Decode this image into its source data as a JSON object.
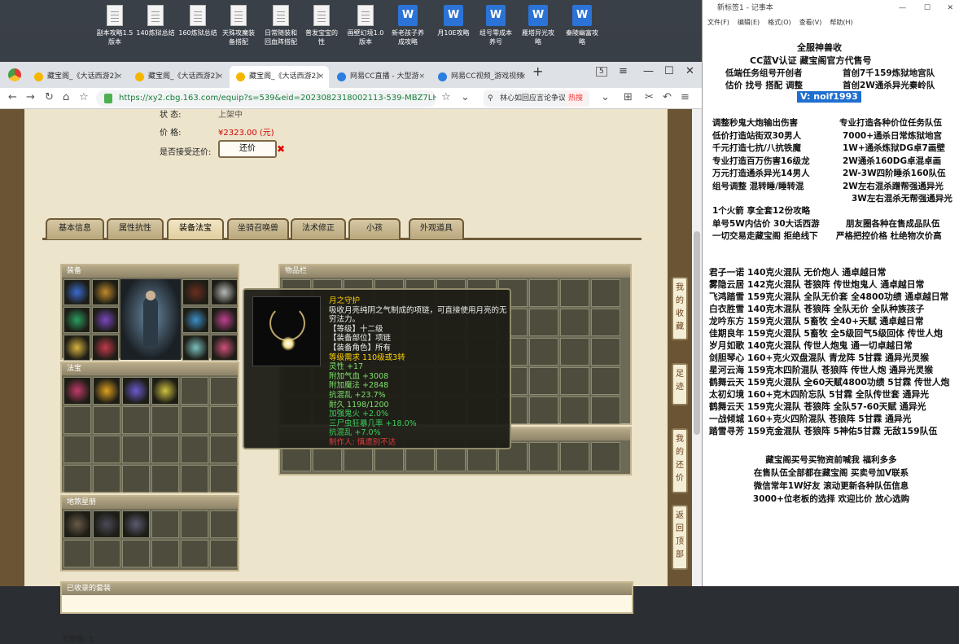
{
  "desktop": {
    "icons": [
      {
        "label": "副本攻略1.5\n版本",
        "type": "file"
      },
      {
        "label": "140炼狱总结",
        "type": "file"
      },
      {
        "label": "160炼狱总结",
        "type": "file"
      },
      {
        "label": "天殊攻魔装\n备搭配",
        "type": "file"
      },
      {
        "label": "日常随装和\n回血阵搭配",
        "type": "file"
      },
      {
        "label": "普发宝宝的\n性",
        "type": "file"
      },
      {
        "label": "画壁幻境1.0\n版本",
        "type": "file"
      },
      {
        "label": "新老孩子养\n成攻略",
        "type": "word"
      },
      {
        "label": "月10E攻略",
        "type": "word"
      },
      {
        "label": "组号零成本\n养号",
        "type": "word"
      },
      {
        "label": "雁塔异光攻\n略",
        "type": "word"
      },
      {
        "label": "秦陵幽富攻\n略",
        "type": "word"
      }
    ]
  },
  "browser": {
    "tabs": [
      "藏宝阁_《大话西游2》",
      "藏宝阁_《大话西游2》",
      "藏宝阁_《大话西游2》",
      "网易CC直播 - 大型游",
      "网易CC视频_游戏视频"
    ],
    "url": "https://xy2.cbg.163.com/equip?s=539&eid=2023082318002113-539-MBZ7LHZEWYY",
    "search": "林心如回应言论争议",
    "hot": "热搜",
    "tab_num": "5"
  },
  "item": {
    "status_label": "状        态:",
    "status_value": "上架中",
    "price_label": "价        格:",
    "price_value": "¥2323.00 (元)",
    "bargain_label": "是否接受还价:",
    "bargain_button": "还价",
    "tabs": [
      "基本信息",
      "属性抗性",
      "装备法宝",
      "坐骑召唤兽",
      "法术修正",
      "小孩",
      "外观道具"
    ],
    "panels": {
      "equip": "装备",
      "items": "物品栏",
      "fabao": "法宝",
      "land": "地煞星册",
      "suits": "已收录的套装",
      "lingxiu": "灵修值:  5"
    }
  },
  "tooltip": {
    "name": "月之守护",
    "desc": "吸收月亮纯阴之气制成的项链，可直接使用月亮的无穷法力。",
    "level": "【等级】十二级",
    "slot": "【装备部位】项链",
    "role": "【装备角色】所有",
    "req": "等级需求 110级或3转",
    "stats_green": [
      "灵性 +17",
      "附加气血 +3008",
      "附加魔法 +2848",
      "抗混乱 +23.7%",
      "耐久 1198/1200"
    ],
    "stats_extra": [
      "加强鬼火 +2.0%",
      "三尸虫狂暴几率 +18.0%",
      "抗混乱 +7.0%"
    ],
    "maker": "制作人: 慎遗别不达"
  },
  "side_buttons": [
    "我的收藏",
    "足迹",
    "我的还价",
    "返回顶部"
  ],
  "notepad": {
    "title": "新标签1 - 记事本",
    "menu": [
      "文件(F)",
      "编辑(E)",
      "格式(O)",
      "查看(V)",
      "帮助(H)"
    ],
    "header1": "全服神兽收",
    "header2": "CC蓝V认证  藏宝阁官方代售号",
    "r1a": "低端任务组号开创者",
    "r1b": "首创7千159炼狱地宫队",
    "r2a": "估价 找号 搭配 调整",
    "r2b": "首创2W通杀异光秦岭队",
    "vline": "V: noif1993",
    "services": [
      [
        "调整秒鬼大炮输出伤害",
        "专业打造各种价位任务队伍"
      ],
      [
        "低价打造站街双30男人",
        "7000+通杀日常炼狱地宫"
      ],
      [
        "千元打造七抗/八抗铁魔",
        "1W+通杀炼狱DG卓7画壁"
      ],
      [
        "专业打造百万伤害16级龙",
        "2W通杀160DG卓混卓画"
      ],
      [
        "万元打造通杀异光14男人",
        "2W-3W四阶睡杀160队伍"
      ],
      [
        "组号调整 混转睡/睡转混",
        "2W左右混杀蹭帮强通异光"
      ]
    ],
    "s7": "3W左右混杀无帮强通异光",
    "s8": "1个火箭 享全套12份攻略",
    "s9a": "单号5W内估价 30大话西游",
    "s9b": "朋友圈各种在售成品队伍",
    "s10a": "一切交易走藏宝阁 拒绝线下",
    "s10b": "严格把控价格 杜绝物次价高",
    "teams": [
      "君子一诺 140克火混队 无价炮人 通卓越日常",
      "雾隐云居 142克火混队 苍狼阵 传世炮鬼人 通卓越日常",
      "飞鸿踏雪 159克火混队 全队无价套 全4800功绩 通卓越日常",
      "白衣胜雪 140克木混队 苍狼阵 全队无价 全队种族孩子",
      "龙吟东方 159克火混队 5畜牧 全40+天赋 通卓越日常",
      "佳期良年 159克火混队 5畜牧 全5级回气5级回体 传世人炮",
      "岁月如歌 140克火混队 传世人炮鬼 通一切卓越日常",
      "剑胆琴心 160+克火双盘混队 青龙阵 5甘霖 通异光灵猴",
      "星河云海 159克木四阶混队 苍狼阵 传世人炮 通异光灵猴",
      "鹤舞云天 159克火混队 全60天赋4800功绩 5甘霖 传世人炮",
      "太初幻境 160+克木四阶忘队 5甘霖 全队传世套 通异光",
      "鹤舞云天 159克火混队 苍狼阵 全队57-60天赋 通异光",
      "一战倾城 160+克火四阶混队 苍狼阵 5甘霖 通异光",
      "踏雪寻芳 159克金混队 苍狼阵 5神佑5甘霖 无敌159队伍"
    ],
    "footer": [
      "藏宝阁买号买物资前喊我 福利多多",
      "在售队伍全部都在藏宝阁 买卖号加V联系",
      "微信常年1W好友 滚动更新各种队伍信息",
      "3000+位老板的选择 欢迎比价 放心选购"
    ]
  }
}
